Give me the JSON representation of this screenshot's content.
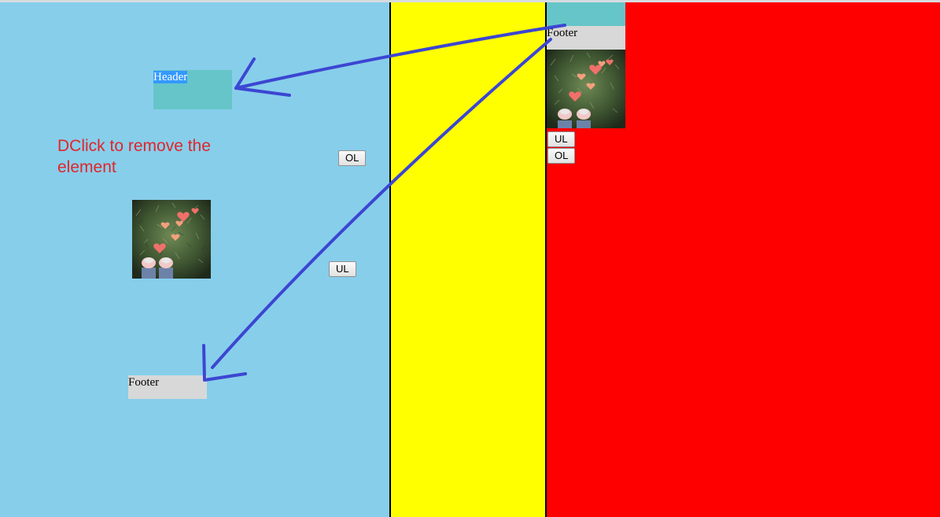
{
  "canvas": {
    "hint_text": "DClick to remove the element",
    "header_label": "Header",
    "footer_label": "Footer",
    "ol_button": "OL",
    "ul_button": "UL"
  },
  "source": {
    "footer_label": "Footer",
    "ul_button": "UL",
    "ol_button": "OL"
  },
  "colors": {
    "canvas_bg": "#87ceeb",
    "palette_bg": "#ffff00",
    "source_bg": "#ff0000",
    "header_bg": "#66c5c8",
    "footer_bg": "#d8d8d8",
    "hint_text": "#e0262a",
    "annotation_arrow": "#3c46d2"
  }
}
